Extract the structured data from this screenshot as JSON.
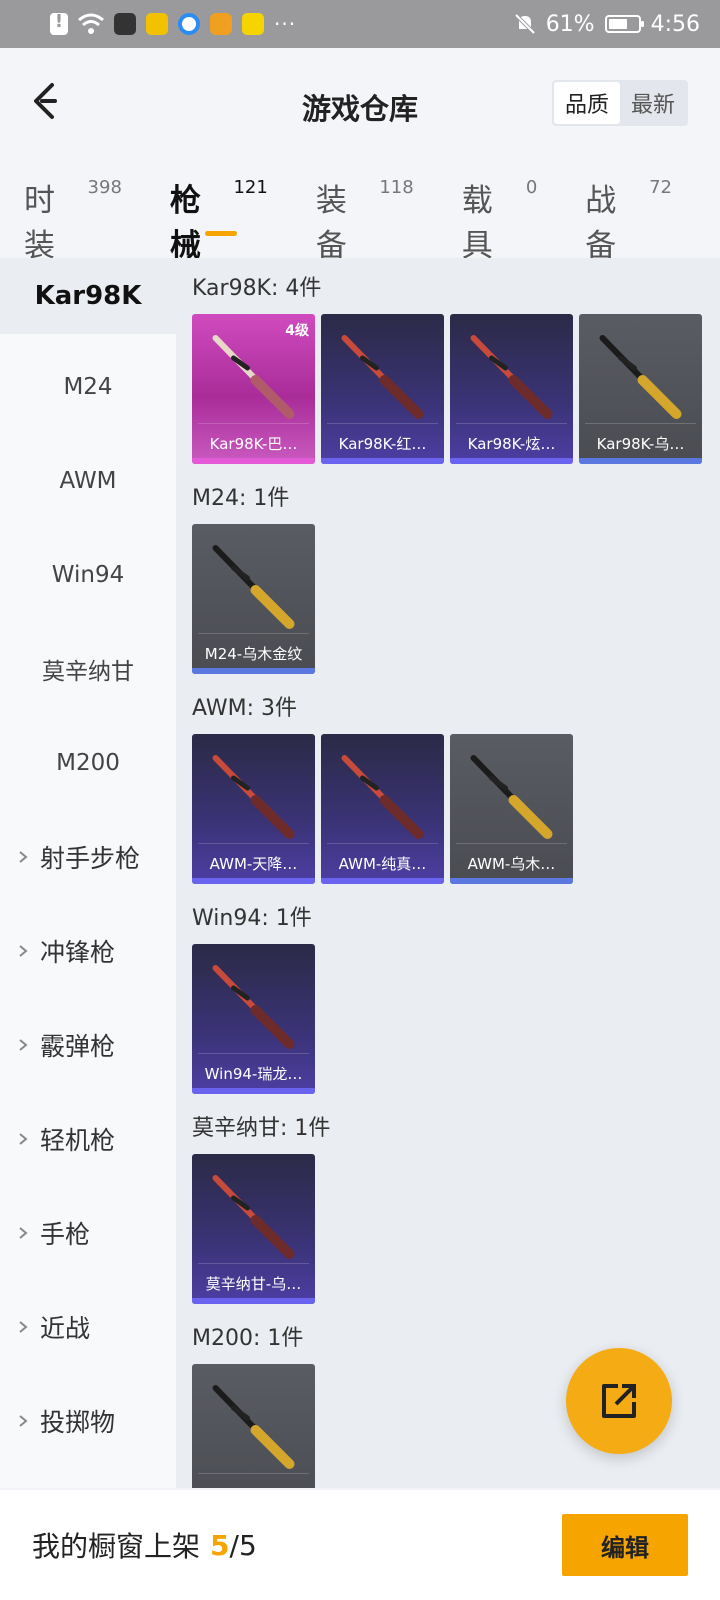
{
  "status_bar": {
    "battery": "61%",
    "time": "4:56"
  },
  "header": {
    "title": "游戏仓库",
    "sort_options": [
      "品质",
      "最新"
    ]
  },
  "tabs": [
    {
      "label": "时装",
      "count": "398"
    },
    {
      "label": "枪械",
      "count": "121"
    },
    {
      "label": "装备",
      "count": "118"
    },
    {
      "label": "载具",
      "count": "0"
    },
    {
      "label": "战备",
      "count": "72"
    }
  ],
  "sidebar": {
    "items": [
      "Kar98K",
      "M24",
      "AWM",
      "Win94",
      "莫辛纳甘",
      "M200"
    ],
    "groups": [
      "射手步枪",
      "冲锋枪",
      "霰弹枪",
      "轻机枪",
      "手枪",
      "近战",
      "投掷物"
    ]
  },
  "sections": [
    {
      "title": "Kar98K: 4件",
      "cards": [
        {
          "name": "Kar98K-巴…",
          "level": "4级",
          "tier": "gold"
        },
        {
          "name": "Kar98K-红…",
          "tier": "purple"
        },
        {
          "name": "Kar98K-炫…",
          "tier": "purple"
        },
        {
          "name": "Kar98K-乌…",
          "tier": "gray"
        }
      ]
    },
    {
      "title": "M24: 1件",
      "cards": [
        {
          "name": "M24-乌木金纹",
          "tier": "gray"
        }
      ]
    },
    {
      "title": "AWM: 3件",
      "cards": [
        {
          "name": "AWM-天降…",
          "tier": "purple"
        },
        {
          "name": "AWM-纯真…",
          "tier": "purple"
        },
        {
          "name": "AWM-乌木…",
          "tier": "gray"
        }
      ]
    },
    {
      "title": "Win94: 1件",
      "cards": [
        {
          "name": "Win94-瑞龙…",
          "tier": "purple"
        }
      ]
    },
    {
      "title": "莫辛纳甘: 1件",
      "cards": [
        {
          "name": "莫辛纳甘-乌…",
          "tier": "purple"
        }
      ]
    },
    {
      "title": "M200: 1件",
      "cards": [
        {
          "name": "",
          "tier": "gray"
        }
      ]
    }
  ],
  "bottom": {
    "shelf_label": "我的橱窗上架",
    "shelf_count": "5",
    "shelf_sep": "/",
    "shelf_total": "5",
    "edit_label": "编辑"
  },
  "colors": {
    "accent": "#f5a400",
    "tier_gold": "#c94fbf",
    "tier_purple": "#3b3377",
    "tier_gray": "#55575d"
  }
}
